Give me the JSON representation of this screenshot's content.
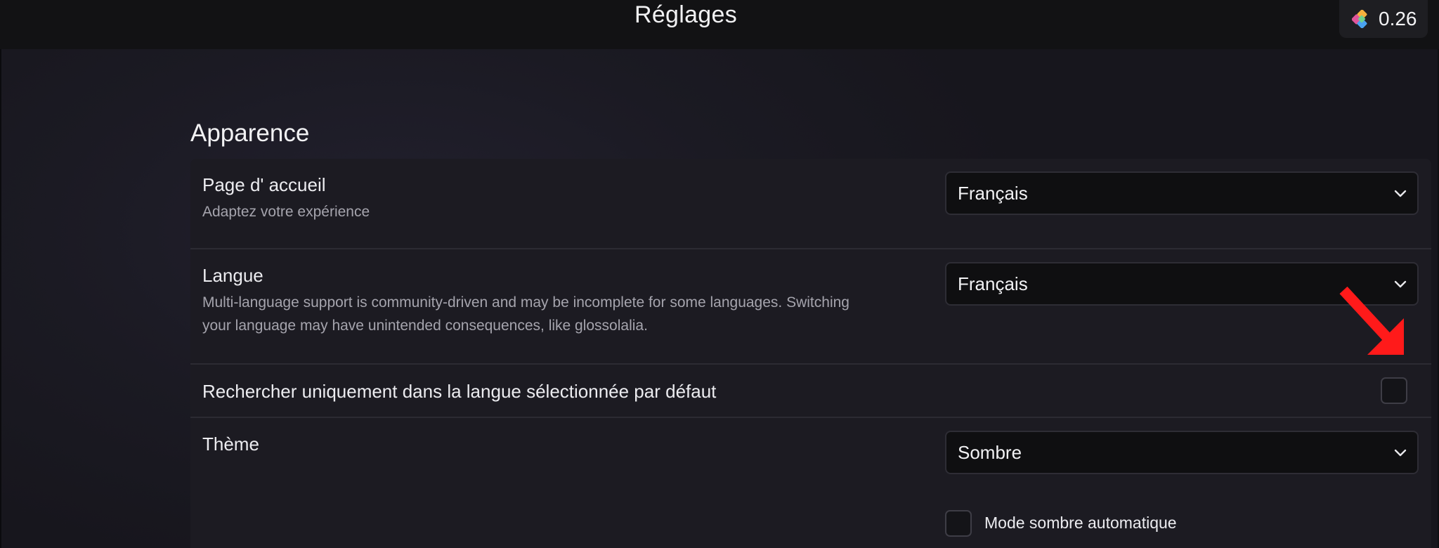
{
  "header": {
    "title": "Réglages",
    "credits": {
      "value": "0.26",
      "icon": "credits-icon"
    }
  },
  "section": {
    "title": "Apparence"
  },
  "settings": {
    "homepage": {
      "label": "Page d' accueil",
      "description": "Adaptez votre expérience",
      "selected": "Français"
    },
    "language": {
      "label": "Langue",
      "description_line1": "Multi-language support is community-driven and may be incomplete for some languages. Switching",
      "description_line2": "your language may have unintended consequences, like glossolalia.",
      "selected": "Français"
    },
    "search_language_only": {
      "label": "Rechercher uniquement dans la langue sélectionnée par défaut",
      "checked": false
    },
    "theme": {
      "label": "Thème",
      "selected": "Sombre",
      "auto_dark": {
        "label": "Mode sombre automatique",
        "checked": false
      }
    }
  },
  "annotation": {
    "icon": "red-arrow-icon",
    "color": "#ff1a1a"
  },
  "colors": {
    "background": "#1b1a23",
    "topbar": "#121214",
    "panel": "#1c1b22",
    "select_bg": "#0f0f11",
    "divider": "#2c2b33",
    "text_primary": "#ececf0",
    "text_secondary": "#a5a4ad",
    "arrow": "#ff1a1a"
  }
}
